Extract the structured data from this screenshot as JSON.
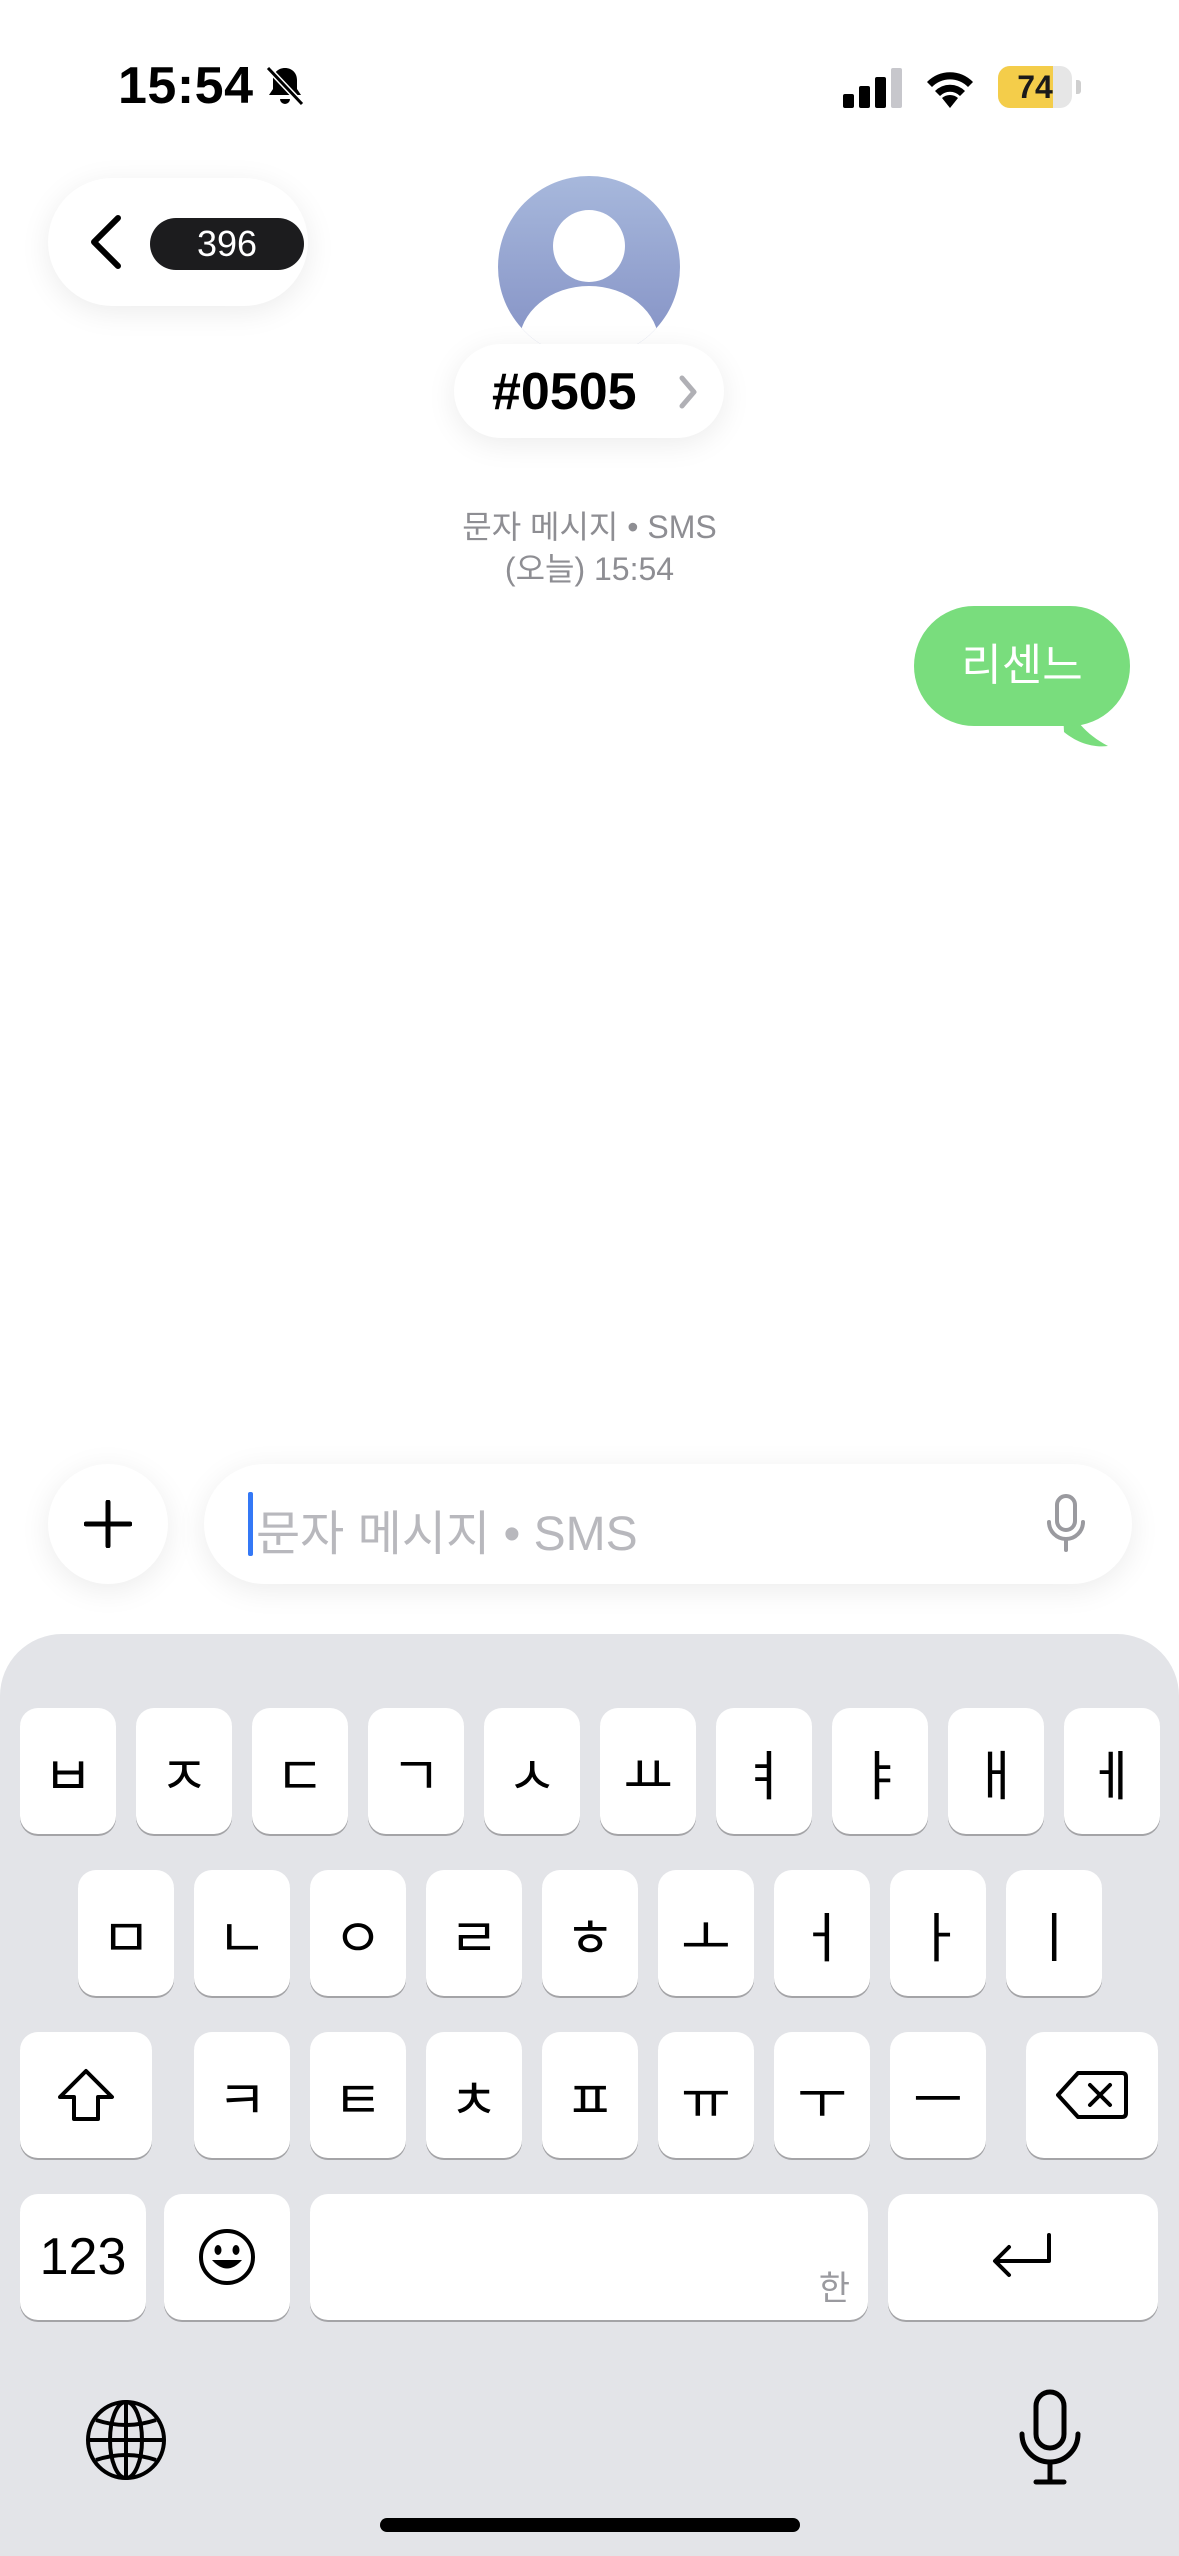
{
  "status_bar": {
    "time": "15:54",
    "battery_level": "74",
    "battery_fraction": 0.74,
    "icons": [
      "bell-slash-icon",
      "cellular-signal-icon",
      "wifi-icon",
      "battery-icon"
    ]
  },
  "header": {
    "unread_count": "396",
    "contact_name": "#0505"
  },
  "conversation": {
    "meta_line1": "문자 메시지 • SMS",
    "meta_line2": "(오늘) 15:54",
    "messages": [
      {
        "text": "리센느",
        "sender": "me"
      }
    ]
  },
  "composer": {
    "placeholder": "문자 메시지 • SMS"
  },
  "keyboard": {
    "row1": [
      "ㅂ",
      "ㅈ",
      "ㄷ",
      "ㄱ",
      "ㅅ",
      "ㅛ",
      "ㅕ",
      "ㅑ",
      "ㅐ",
      "ㅔ"
    ],
    "row2": [
      "ㅁ",
      "ㄴ",
      "ㅇ",
      "ㄹ",
      "ㅎ",
      "ㅗ",
      "ㅓ",
      "ㅏ",
      "ㅣ"
    ],
    "row3": [
      "ㅋ",
      "ㅌ",
      "ㅊ",
      "ㅍ",
      "ㅠ",
      "ㅜ",
      "ㅡ"
    ],
    "numbers_label": "123",
    "space_hint": "한"
  },
  "colors": {
    "bubble": "#79dd7d",
    "keyboard_bg": "#e3e4e8",
    "caret": "#3478f6",
    "battery": "#f4cd4a"
  }
}
